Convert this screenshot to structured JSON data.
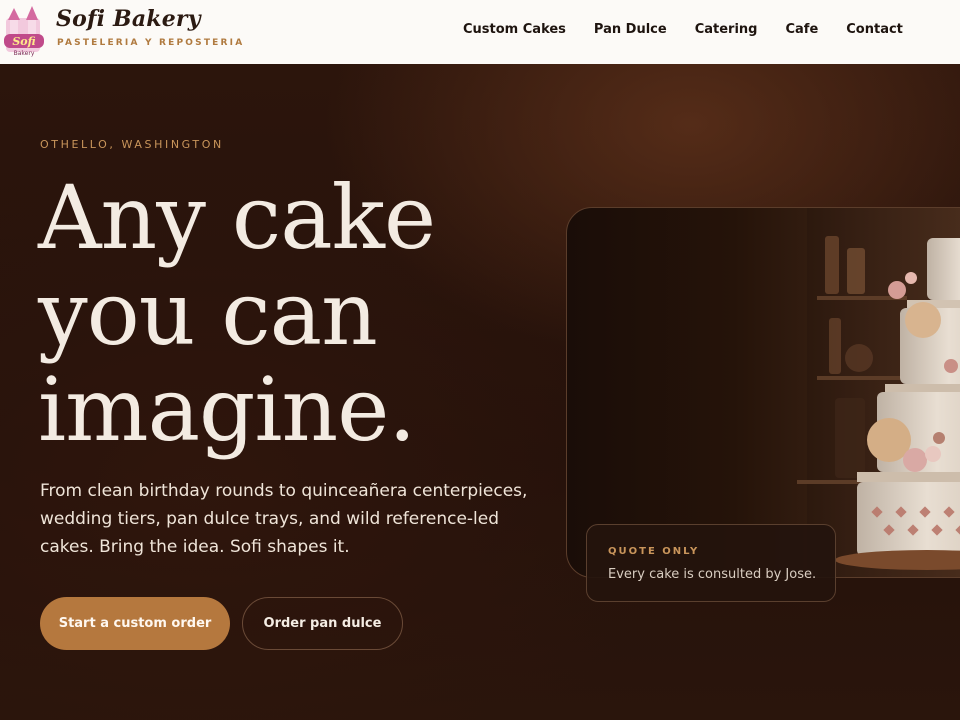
{
  "header": {
    "brand_name": "Sofi Bakery",
    "brand_tagline": "PASTELERIA Y REPOSTERIA",
    "logo_text": "Sofi",
    "logo_sub": "Bakery",
    "nav": [
      {
        "label": "Custom Cakes"
      },
      {
        "label": "Pan Dulce"
      },
      {
        "label": "Catering"
      },
      {
        "label": "Cafe"
      },
      {
        "label": "Contact"
      }
    ]
  },
  "hero": {
    "eyebrow": "OTHELLO, WASHINGTON",
    "headline_line1": "Any cake",
    "headline_line2": "you can",
    "headline_line3": "imagine.",
    "lede": "From clean birthday rounds to quinceañera centerpieces, wedding tiers, pan dulce trays, and wild reference-led cakes. Bring the idea. Sofi shapes it.",
    "primary_cta": "Start a custom order",
    "secondary_cta": "Order pan dulce"
  },
  "quote_card": {
    "label": "QUOTE ONLY",
    "text": "Every cake is consulted by Jose."
  },
  "colors": {
    "accent": "#b5783e",
    "eyebrow": "#c9955b",
    "background": "#2a140c",
    "header_bg": "#fcfaf7"
  }
}
